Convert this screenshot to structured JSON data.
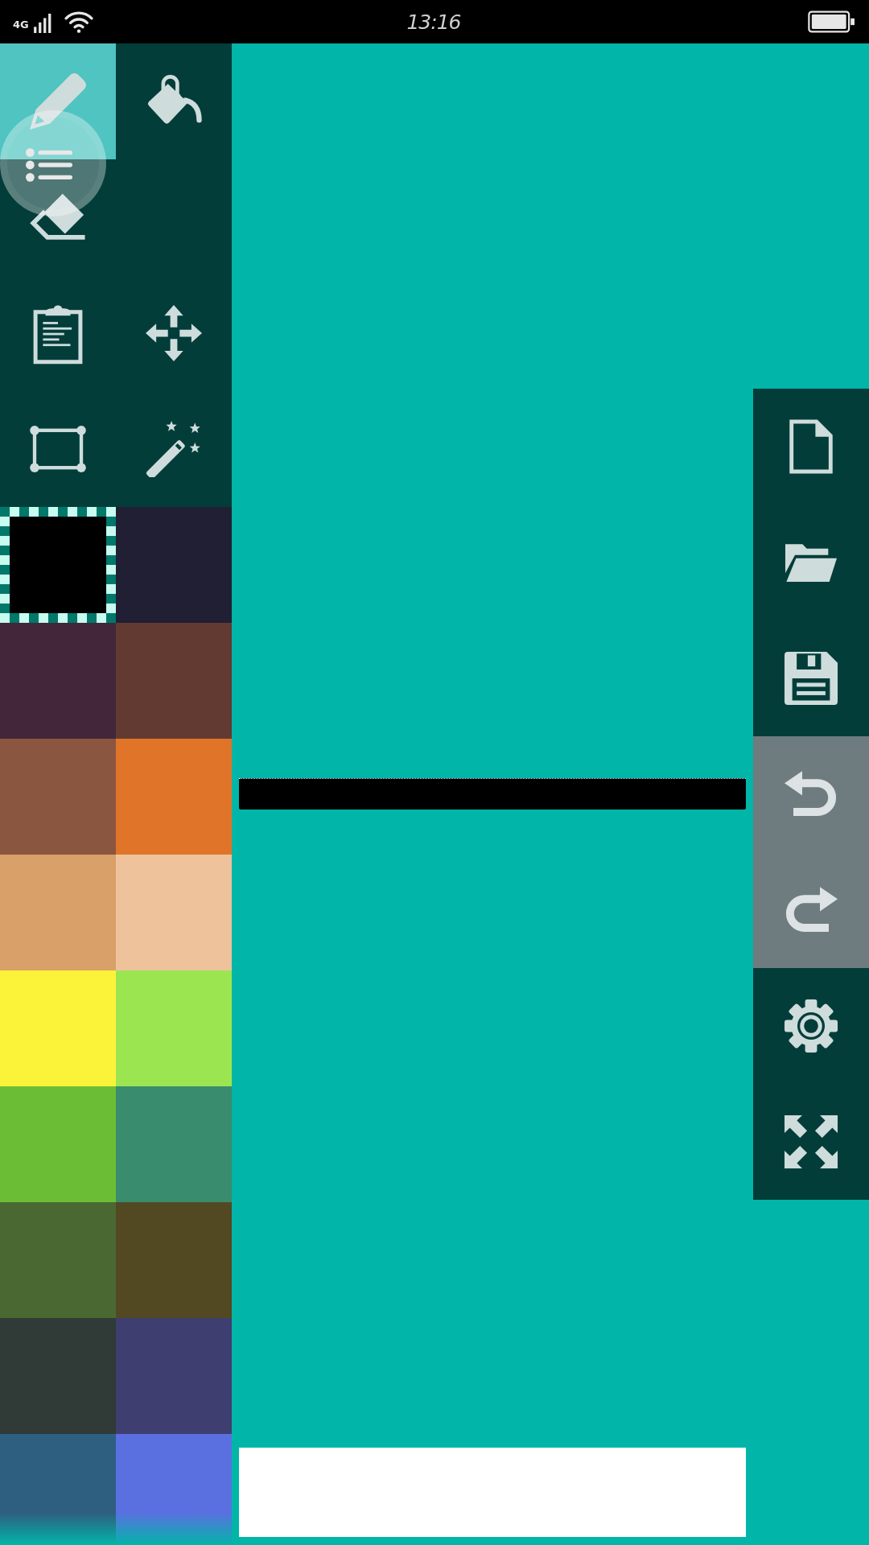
{
  "status_bar": {
    "network": "4G",
    "time": "13:16"
  },
  "tool_rows": [
    [
      {
        "kind": "pencil",
        "selected": true
      },
      {
        "kind": "bucket",
        "selected": false
      }
    ],
    [
      {
        "kind": "eraser",
        "selected": false
      }
    ],
    [
      {
        "kind": "clipboard",
        "selected": false
      },
      {
        "kind": "move",
        "selected": false
      }
    ],
    [
      {
        "kind": "rectangle",
        "selected": false
      },
      {
        "kind": "wand",
        "selected": false
      }
    ]
  ],
  "palette": [
    {
      "color": "#000000",
      "selected": true
    },
    {
      "color": "#211f33",
      "selected": false
    },
    {
      "color": "#43263a",
      "selected": false
    },
    {
      "color": "#633a32",
      "selected": false
    },
    {
      "color": "#8b563f",
      "selected": false
    },
    {
      "color": "#e07428",
      "selected": false
    },
    {
      "color": "#d9a06a",
      "selected": false
    },
    {
      "color": "#eec39c",
      "selected": false
    },
    {
      "color": "#fbf23a",
      "selected": false
    },
    {
      "color": "#9be650",
      "selected": false
    },
    {
      "color": "#6bbd35",
      "selected": false
    },
    {
      "color": "#3a8c6e",
      "selected": false
    },
    {
      "color": "#4a6832",
      "selected": false
    },
    {
      "color": "#524923",
      "selected": false
    },
    {
      "color": "#303a37",
      "selected": false
    },
    {
      "color": "#3f3e70",
      "selected": false
    },
    {
      "color": "#2e5f80",
      "selected": false
    },
    {
      "color": "#5a70e0",
      "selected": false
    }
  ],
  "side_toolbar": [
    {
      "kind": "new",
      "disabled": false
    },
    {
      "kind": "open",
      "disabled": false
    },
    {
      "kind": "save",
      "disabled": false
    },
    {
      "kind": "undo",
      "disabled": true
    },
    {
      "kind": "redo",
      "disabled": true
    },
    {
      "kind": "settings",
      "disabled": false
    },
    {
      "kind": "fullscreen",
      "disabled": false
    }
  ]
}
